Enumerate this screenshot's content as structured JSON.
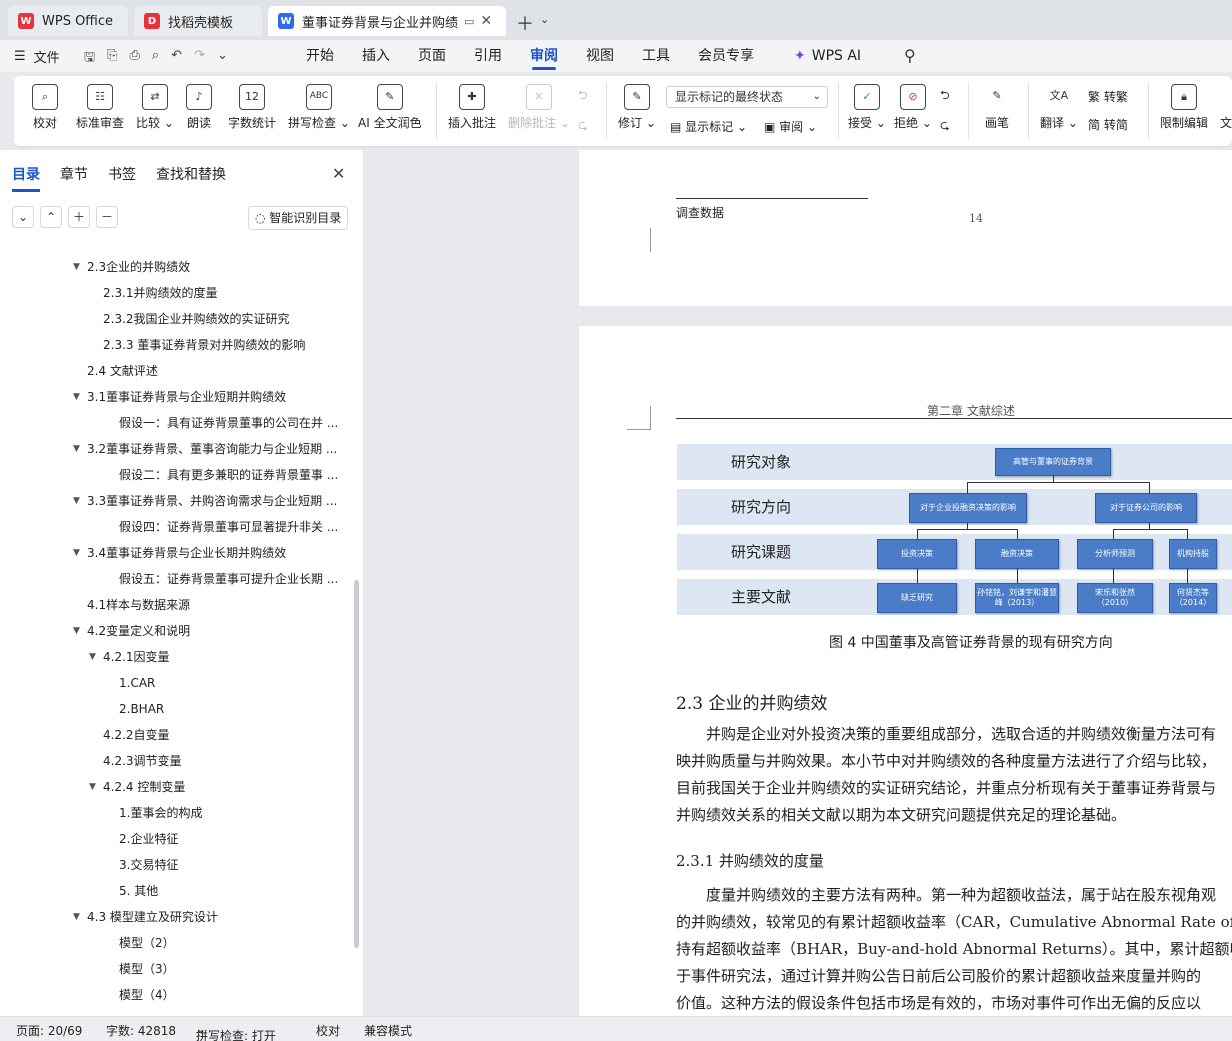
{
  "tabs": [
    {
      "label": "WPS Office",
      "icon": "wps-logo-icon",
      "color": "#e8323c"
    },
    {
      "label": "找稻壳模板",
      "icon": "docer-logo-icon",
      "color": "#e8323c"
    },
    {
      "label": "董事证券背景与企业并购绩效",
      "icon": "word-doc-icon",
      "color": "#2f6be8"
    }
  ],
  "menubar": {
    "file_label": "文件",
    "menus": [
      "开始",
      "插入",
      "页面",
      "引用",
      "审阅",
      "视图",
      "工具",
      "会员专享"
    ],
    "active_menu": "审阅",
    "ai_label": "WPS AI"
  },
  "ribbon": {
    "proof": "校对",
    "standard_review": "标准审查",
    "compare": "比较",
    "read_aloud": "朗读",
    "word_count": "字数统计",
    "spell_check": "拼写检查",
    "ai_polish": "AI 全文润色",
    "insert_comment": "插入批注",
    "delete_comment": "删除批注",
    "track_changes": "修订",
    "markup_select": "显示标记的最终状态",
    "show_markup": "显示标记",
    "review": "审阅",
    "accept": "接受",
    "reject": "拒绝",
    "pen": "画笔",
    "translate": "翻译",
    "to_traditional": "转繁",
    "to_simplified": "转简",
    "restrict_edit": "限制编辑",
    "more_cut": "文"
  },
  "nav": {
    "tabs": [
      "目录",
      "章节",
      "书签",
      "查找和替换"
    ],
    "active_tab": "目录",
    "smart_btn": "智能识别目录",
    "toc": [
      {
        "text": "2.3企业的并购绩效",
        "level": 1,
        "expander": "▼"
      },
      {
        "text": "2.3.1并购绩效的度量",
        "level": 2,
        "expander": ""
      },
      {
        "text": "2.3.2我国企业并购绩效的实证研究",
        "level": 2,
        "expander": ""
      },
      {
        "text": "2.3.3 董事证券背景对并购绩效的影响",
        "level": 2,
        "expander": ""
      },
      {
        "text": "2.4 文献评述",
        "level": 1,
        "expander": ""
      },
      {
        "text": "3.1董事证券背景与企业短期并购绩效",
        "level": 1,
        "expander": "▼"
      },
      {
        "text": "假设一：具有证券背景董事的公司在并 ...",
        "level": 3,
        "expander": ""
      },
      {
        "text": "3.2董事证券背景、董事咨询能力与企业短期 ...",
        "level": 1,
        "expander": "▼"
      },
      {
        "text": "假设二：具有更多兼职的证券背景董事 ...",
        "level": 3,
        "expander": ""
      },
      {
        "text": "3.3董事证券背景、并购咨询需求与企业短期 ...",
        "level": 1,
        "expander": "▼"
      },
      {
        "text": "假设四：证券背景董事可显著提升非关 ...",
        "level": 3,
        "expander": ""
      },
      {
        "text": "3.4董事证券背景与企业长期并购绩效",
        "level": 1,
        "expander": "▼"
      },
      {
        "text": "假设五：证券背景董事可提升企业长期 ...",
        "level": 3,
        "expander": ""
      },
      {
        "text": "4.1样本与数据来源",
        "level": 1,
        "expander": ""
      },
      {
        "text": "4.2变量定义和说明",
        "level": 1,
        "expander": "▼"
      },
      {
        "text": "4.2.1因变量",
        "level": 2,
        "expander": "▼"
      },
      {
        "text": "1.CAR",
        "level": 3,
        "expander": ""
      },
      {
        "text": "2.BHAR",
        "level": 3,
        "expander": ""
      },
      {
        "text": "4.2.2自变量",
        "level": 2,
        "expander": ""
      },
      {
        "text": "4.2.3调节变量",
        "level": 2,
        "expander": ""
      },
      {
        "text": "4.2.4 控制变量",
        "level": 2,
        "expander": "▼"
      },
      {
        "text": "1.董事会的构成",
        "level": 3,
        "expander": ""
      },
      {
        "text": "2.企业特征",
        "level": 3,
        "expander": ""
      },
      {
        "text": "3.交易特征",
        "level": 3,
        "expander": ""
      },
      {
        "text": "5. 其他",
        "level": 3,
        "expander": ""
      },
      {
        "text": "4.3 模型建立及研究设计",
        "level": 1,
        "expander": "▼"
      },
      {
        "text": "模型（2）",
        "level": 3,
        "expander": ""
      },
      {
        "text": "模型（3）",
        "level": 3,
        "expander": ""
      },
      {
        "text": "模型（4）",
        "level": 3,
        "expander": ""
      }
    ]
  },
  "doc": {
    "footnote": "调查数据",
    "page_number": "14",
    "header": "第二章  文献综述",
    "diagram": {
      "bands": [
        "研究对象",
        "研究方向",
        "研究课题",
        "主要文献"
      ],
      "root": "高管与董事的证券背景",
      "directions": [
        "对于企业投融资决策的影响",
        "对于证券公司的影响"
      ],
      "topics": [
        "投资决策",
        "融资决策",
        "分析师预测",
        "机构持股"
      ],
      "literature": [
        "缺乏研究",
        "孙铭铭，刘谦宇和潘慧峰（2013）",
        "宋乐和张然（2010）",
        "何贤杰等（2014）"
      ]
    },
    "caption": "图 4 中国董事及高管证券背景的现有研究方向",
    "h2": "2.3  企业的并购绩效",
    "para1": [
      "并购是企业对外投资决策的重要组成部分，选取合适的并购绩效衡量方法可有",
      "映并购质量与并购效果。本小节中对并购绩效的各种度量方法进行了介绍与比较，",
      "目前我国关于企业并购绩效的实证研究结论，并重点分析现有关于董事证券背景与",
      "并购绩效关系的相关文献以期为本文研究问题提供充足的理论基础。"
    ],
    "h3": "2.3.1  并购绩效的度量",
    "para2": [
      "度量并购绩效的主要方法有两种。第一种为超额收益法，属于站在股东视角观",
      "的并购绩效，较常见的有累计超额收益率（CAR，Cumulative Abnormal Rate of Retu",
      "持有超额收益率（BHAR，Buy-and-hold Abnormal Returns）。其中，累计超额收益",
      "于事件研究法，通过计算并购公告日前后公司股价的累计超额收益来度量并购的",
      "价值。这种方法的假设条件包括市场是有效的，市场对事件可作出无偏的反应以"
    ]
  },
  "status": {
    "page": "页面: 20/69",
    "words": "字数: 42818",
    "spell": "拼写检查: 打开",
    "proof": "校对",
    "compat": "兼容模式"
  }
}
